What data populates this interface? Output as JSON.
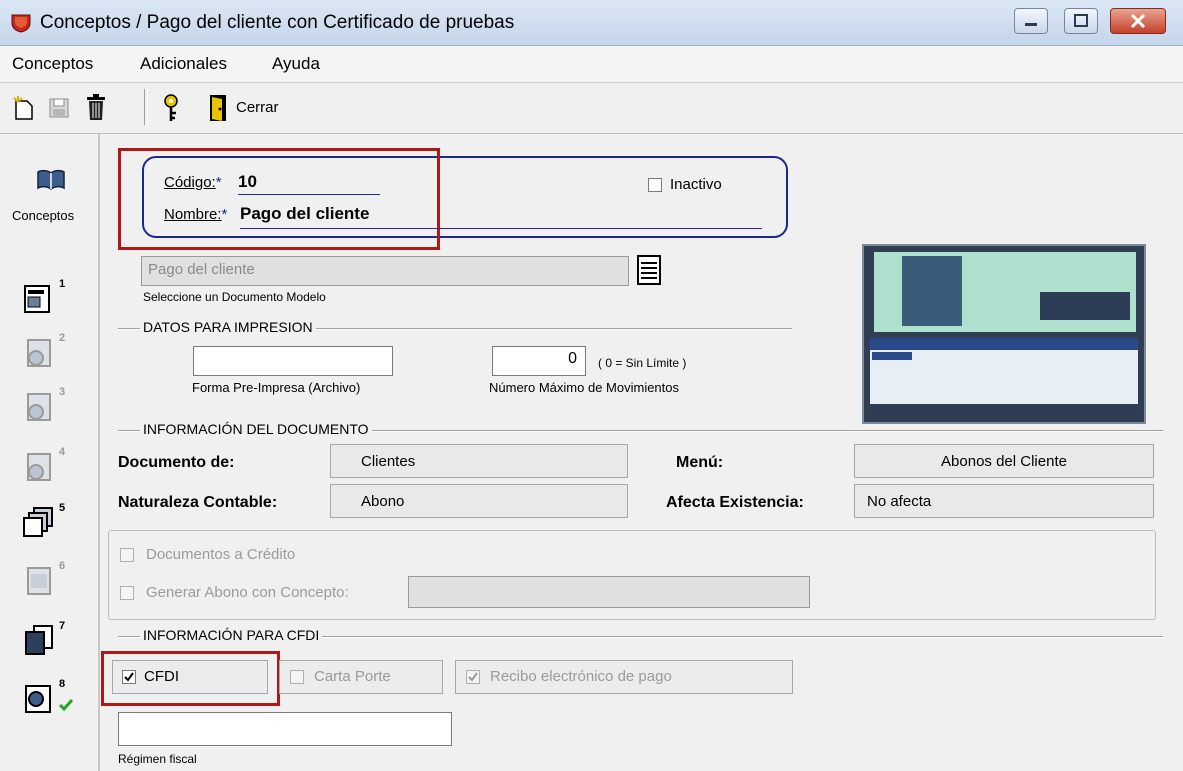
{
  "window": {
    "title": "Conceptos / Pago del cliente con Certificado de pruebas"
  },
  "menu": {
    "items": [
      "Conceptos",
      "Adicionales",
      "Ayuda"
    ]
  },
  "toolbar": {
    "close_label": "Cerrar"
  },
  "sidebar": {
    "conceptos_label": "Conceptos",
    "nums": [
      "1",
      "2",
      "3",
      "4",
      "5",
      "6",
      "7",
      "8"
    ]
  },
  "form": {
    "codigo_label": "Código:",
    "codigo_value": "10",
    "nombre_label": "Nombre:",
    "nombre_value": "Pago del cliente",
    "required_mark": "*",
    "inactivo_label": "Inactivo",
    "modelo_value": "Pago del cliente",
    "modelo_caption": "Seleccione un Documento Modelo"
  },
  "impresion": {
    "group_label": "DATOS PARA IMPRESION",
    "forma_caption": "Forma Pre-Impresa (Archivo)",
    "forma_value": "",
    "max_mov_value": "0",
    "max_mov_hint": "( 0 = Sin Límite )",
    "max_mov_caption": "Número Máximo de Movimientos"
  },
  "documento": {
    "group_label": "INFORMACIÓN  DEL DOCUMENTO",
    "documento_de_label": "Documento de:",
    "documento_de_value": "Clientes",
    "menu_label": "Menú:",
    "menu_value": "Abonos del Cliente",
    "naturaleza_label": "Naturaleza Contable:",
    "naturaleza_value": "Abono",
    "afecta_label": "Afecta Existencia:",
    "afecta_value": "No afecta",
    "credito_label": "Documentos a Crédito",
    "abono_label": "Generar Abono con Concepto:"
  },
  "cfdi": {
    "group_label": "INFORMACIÓN PARA CFDI",
    "cfdi_label": "CFDI",
    "carta_porte_label": "Carta Porte",
    "recibo_label": "Recibo electrónico de pago",
    "regimen_caption": "Régimen fiscal",
    "regimen_value": ""
  },
  "colors": {
    "highlight": "#b01818",
    "frame": "#1a2a8a"
  }
}
